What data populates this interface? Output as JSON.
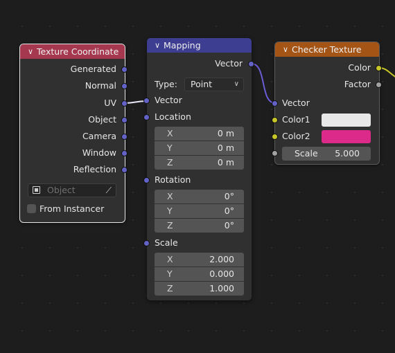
{
  "colors": {
    "texcoord_header": "#a5374f",
    "mapping_header": "#3d3d92",
    "checker_header": "#a45516",
    "vector_socket": "#6363c7",
    "color_socket": "#c7c729",
    "float_socket": "#a1a1a1",
    "color1_swatch": "#e8e8e8",
    "color2_swatch": "#dc2a8a"
  },
  "texture_coordinate": {
    "title": "Texture Coordinate",
    "outputs": [
      "Generated",
      "Normal",
      "UV",
      "Object",
      "Camera",
      "Window",
      "Reflection"
    ],
    "object_placeholder": "Object",
    "from_instancer_label": "From Instancer"
  },
  "mapping": {
    "title": "Mapping",
    "output_vector": "Vector",
    "type_label": "Type:",
    "type_value": "Point",
    "input_vector": "Vector",
    "location_label": "Location",
    "location": [
      {
        "axis": "X",
        "value": "0 m"
      },
      {
        "axis": "Y",
        "value": "0 m"
      },
      {
        "axis": "Z",
        "value": "0 m"
      }
    ],
    "rotation_label": "Rotation",
    "rotation": [
      {
        "axis": "X",
        "value": "0°"
      },
      {
        "axis": "Y",
        "value": "0°"
      },
      {
        "axis": "Z",
        "value": "0°"
      }
    ],
    "scale_label": "Scale",
    "scale": [
      {
        "axis": "X",
        "value": "2.000"
      },
      {
        "axis": "Y",
        "value": "0.000"
      },
      {
        "axis": "Z",
        "value": "1.000"
      }
    ]
  },
  "checker_texture": {
    "title": "Checker Texture",
    "output_color": "Color",
    "output_factor": "Factor",
    "input_vector": "Vector",
    "color1_label": "Color1",
    "color2_label": "Color2",
    "scale_label": "Scale",
    "scale_value": "5.000"
  }
}
